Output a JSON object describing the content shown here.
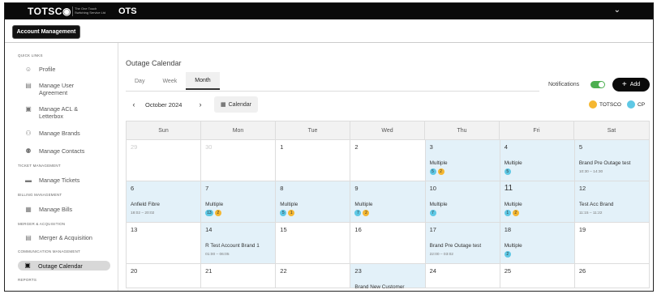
{
  "header": {
    "logo_text": "TOTSC◉",
    "logo_subtext": "The One Touch Switching Service Ltd",
    "app_name": "OTS",
    "menu_chevron": "⌄",
    "account_button": "Account Management"
  },
  "sidebar": {
    "sections": [
      {
        "title": "QUICK LINKS"
      },
      {
        "title": "TICKET MANAGEMENT"
      },
      {
        "title": "BILLING MANAGEMENT"
      },
      {
        "title": "MERGER & ACQUISITION"
      },
      {
        "title": "COMMUNICATION MANAGEMENT"
      },
      {
        "title": "REPORTS"
      }
    ],
    "items": [
      {
        "label": "Profile",
        "icon": "user-circle-icon",
        "glyph": "☺"
      },
      {
        "label": "Manage User Agreement",
        "icon": "document-icon",
        "glyph": "▤"
      },
      {
        "label": "Manage ACL & Letterbox",
        "icon": "mailbox-icon",
        "glyph": "▣"
      },
      {
        "label": "Manage Brands",
        "icon": "users-icon",
        "glyph": "⚇"
      },
      {
        "label": "Manage Contacts",
        "icon": "contacts-icon",
        "glyph": "⚉"
      },
      {
        "label": "Manage Tickets",
        "icon": "ticket-icon",
        "glyph": "▬"
      },
      {
        "label": "Manage Bills",
        "icon": "bill-icon",
        "glyph": "▦"
      },
      {
        "label": "Merger & Acquisition",
        "icon": "merge-icon",
        "glyph": "▤"
      },
      {
        "label": "Outage Calendar",
        "icon": "calendar-icon",
        "glyph": "▣"
      }
    ]
  },
  "main": {
    "page_title": "Outage Calendar",
    "view_tabs": [
      "Day",
      "Week",
      "Month"
    ],
    "active_tab": "Month",
    "notifications_label": "Notifications",
    "notifications_on": true,
    "add_button": "Add",
    "month_label": "October 2024",
    "calendar_button": "Calendar",
    "prev_icon": "‹",
    "next_icon": "›",
    "legend": [
      {
        "label": "TOTSCO",
        "color": "#f5b731"
      },
      {
        "label": "CP",
        "color": "#5ec8e5"
      }
    ]
  },
  "calendar": {
    "weekdays": [
      "Sun",
      "Mon",
      "Tue",
      "Wed",
      "Thu",
      "Fri",
      "Sat"
    ],
    "weeks": [
      [
        {
          "num": "29",
          "faded": true
        },
        {
          "num": "30",
          "faded": true
        },
        {
          "num": "1"
        },
        {
          "num": "2"
        },
        {
          "num": "3",
          "hl": true,
          "event": "Multiple",
          "badges": [
            {
              "type": "cp",
              "n": "5"
            },
            {
              "type": "tots",
              "n": "2"
            }
          ]
        },
        {
          "num": "4",
          "hl": true,
          "event": "Multiple",
          "badges": [
            {
              "type": "cp",
              "n": "5"
            }
          ]
        },
        {
          "num": "5",
          "hl": true,
          "event": "Brand Pre Outage test",
          "time": "10:30 – 14:30"
        }
      ],
      [
        {
          "num": "6",
          "hl": true,
          "event": "Anfield Fibre",
          "time": "18:02 – 20:02"
        },
        {
          "num": "7",
          "hl": true,
          "event": "Multiple",
          "badges": [
            {
              "type": "cp",
              "n": "13"
            },
            {
              "type": "tots",
              "n": "2"
            }
          ]
        },
        {
          "num": "8",
          "hl": true,
          "event": "Multiple",
          "badges": [
            {
              "type": "cp",
              "n": "5"
            },
            {
              "type": "tots",
              "n": "1"
            }
          ]
        },
        {
          "num": "9",
          "hl": true,
          "event": "Multiple",
          "badges": [
            {
              "type": "cp",
              "n": "7"
            },
            {
              "type": "tots",
              "n": "2"
            }
          ]
        },
        {
          "num": "10",
          "hl": true,
          "event": "Multiple",
          "badges": [
            {
              "type": "cp",
              "n": "7"
            }
          ]
        },
        {
          "num": "11",
          "hl": true,
          "big": true,
          "event": "Multiple",
          "badges": [
            {
              "type": "cp",
              "n": "1"
            },
            {
              "type": "tots",
              "n": "2"
            }
          ]
        },
        {
          "num": "12",
          "hl": true,
          "event": "Test Acc Brand",
          "time": "11:15 – 11:22"
        }
      ],
      [
        {
          "num": "13"
        },
        {
          "num": "14",
          "hl": true,
          "event": "R Test Account Brand 1",
          "time": "01:00 – 06:05"
        },
        {
          "num": "15"
        },
        {
          "num": "16"
        },
        {
          "num": "17",
          "hl": true,
          "event": "Brand Pre Outage test",
          "time": "22:00 – 03:02"
        },
        {
          "num": "18",
          "hl": true,
          "event": "Multiple",
          "badges": [
            {
              "type": "cp",
              "n": "2"
            }
          ]
        },
        {
          "num": "19"
        }
      ],
      [
        {
          "num": "20"
        },
        {
          "num": "21"
        },
        {
          "num": "22"
        },
        {
          "num": "23",
          "hl": true,
          "event": "Brand New Customer"
        },
        {
          "num": "24"
        },
        {
          "num": "25"
        },
        {
          "num": "26"
        }
      ]
    ]
  }
}
